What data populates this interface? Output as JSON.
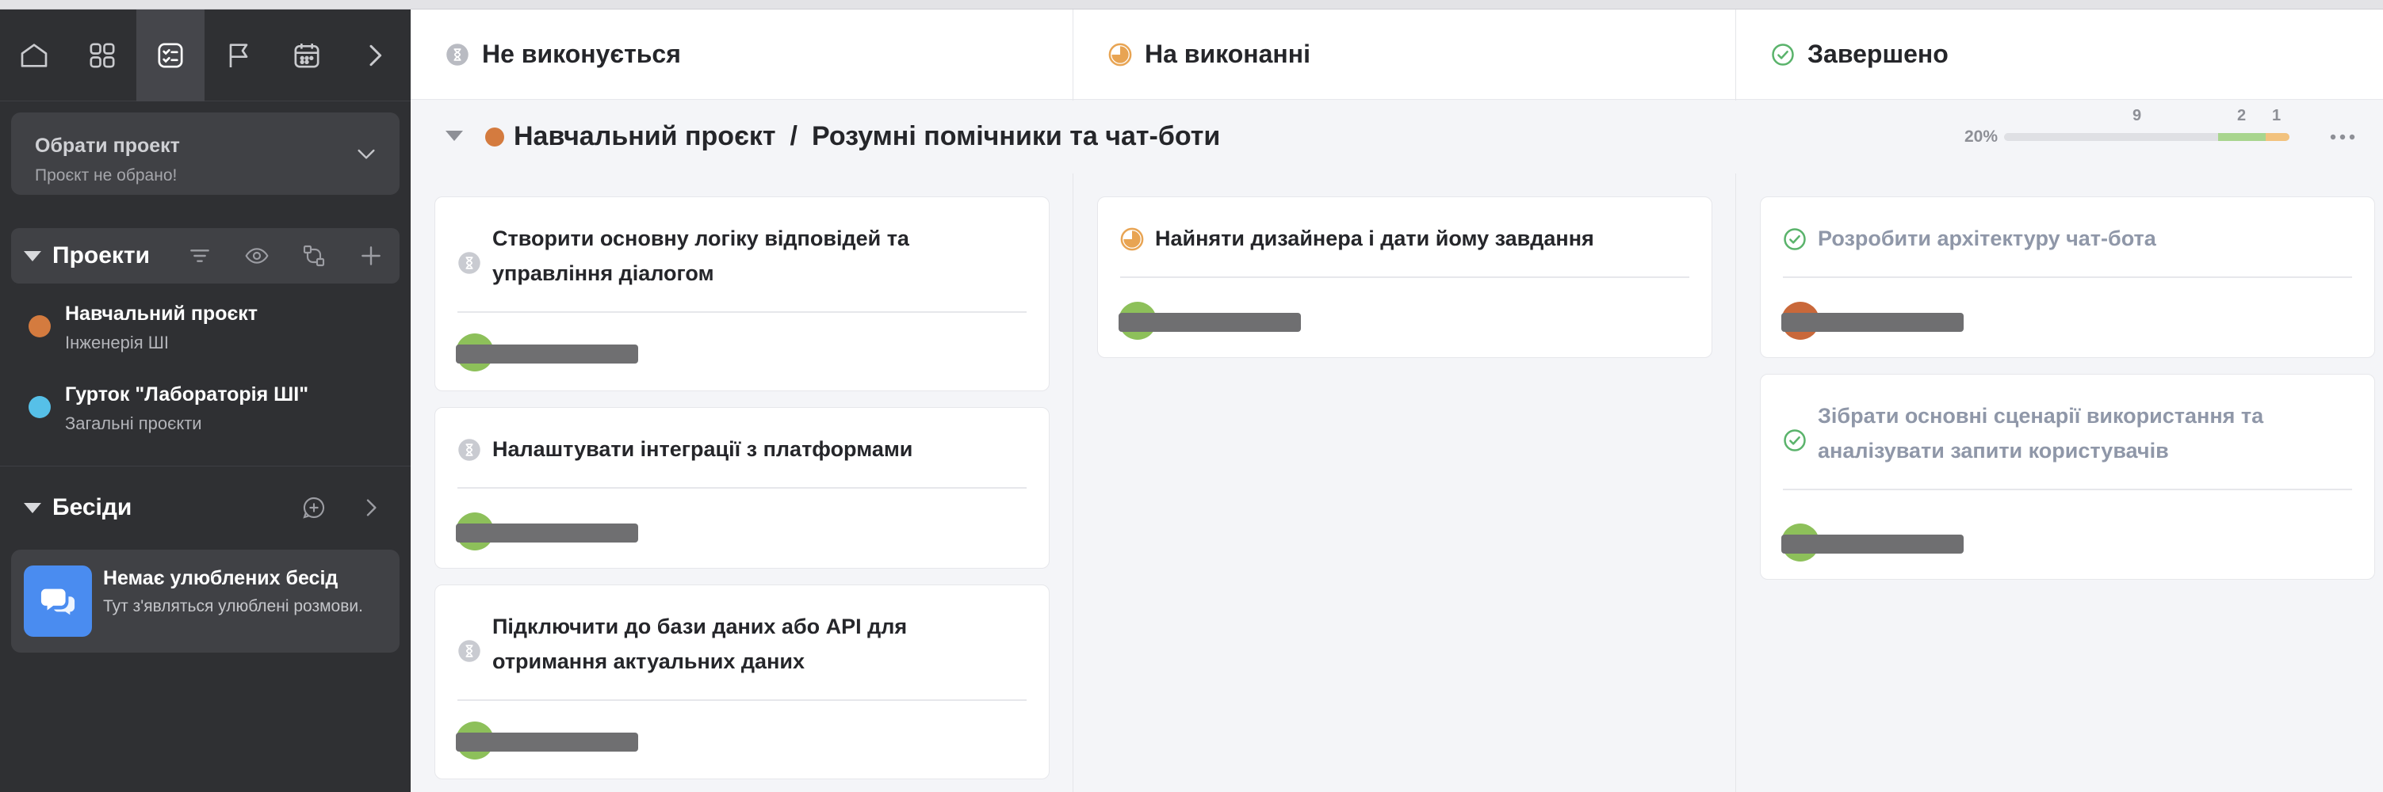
{
  "sidebar": {
    "nav": [
      {
        "name": "home-icon"
      },
      {
        "name": "grid-icon"
      },
      {
        "name": "tasks-icon",
        "active": true
      },
      {
        "name": "flag-icon"
      },
      {
        "name": "calendar-icon"
      },
      {
        "name": "chevron-right-icon"
      }
    ],
    "project_select": {
      "title": "Обрати проект",
      "subtitle": "Проєкт не обрано!"
    },
    "projects_section": {
      "title": "Проекти"
    },
    "projects": [
      {
        "name": "Навчальний проєкт",
        "category": "Інженерія ШІ",
        "color": "#d47b3f"
      },
      {
        "name": "Гурток \"Лабораторія ШІ\"",
        "category": "Загальні проєкти",
        "color": "#56c0e8"
      }
    ],
    "chats_section": {
      "title": "Бесіди"
    },
    "empty_chats": {
      "title": "Немає улюблених бесід",
      "text": "Тут з'являться улюблені розмови."
    }
  },
  "columns": [
    {
      "label": "Не виконується",
      "status": "todo"
    },
    {
      "label": "На виконанні",
      "status": "inprogress"
    },
    {
      "label": "Завершено",
      "status": "done"
    }
  ],
  "group": {
    "project": "Навчальний проєкт",
    "separator": "/",
    "name": "Розумні помічники та чат-боти",
    "progress": {
      "percent_label": "20%",
      "todo_count": "9",
      "inprogress_count": "2",
      "done_count": "1"
    }
  },
  "colors": {
    "todo": "#b9bbc2",
    "inprogress": "#e8a453",
    "done": "#5ab36b",
    "accent_green": "#8dc05a"
  },
  "cards": {
    "todo": [
      {
        "title": "Створити основну логіку відповідей та управління діалогом"
      },
      {
        "title": "Налаштувати інтеграції з платформами"
      },
      {
        "title": "Підключити до бази даних або API для отримання актуальних даних"
      }
    ],
    "inprogress": [
      {
        "title": "Найняти дизайнера і дати йому завдання"
      }
    ],
    "done": [
      {
        "title": "Розробити архітектуру чат-бота"
      },
      {
        "title": "Зібрати основні сценарії використання та аналізувати запити користувачів"
      }
    ]
  }
}
